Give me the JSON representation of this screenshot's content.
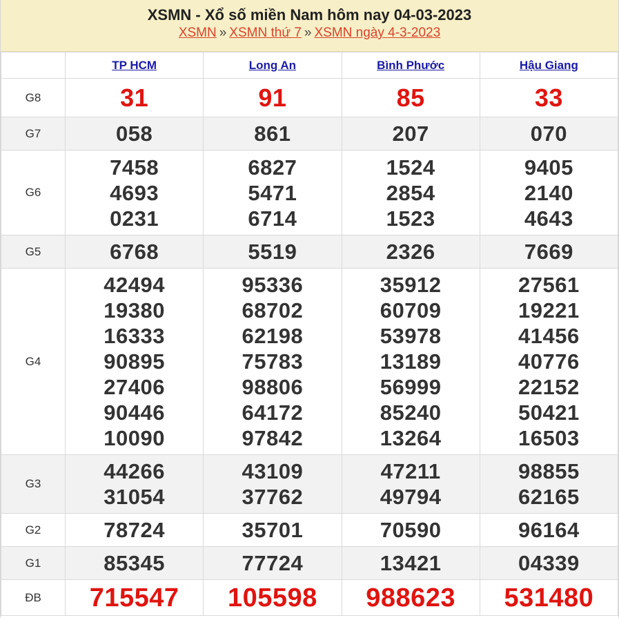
{
  "header": {
    "title": "XSMN - Xổ số miền Nam hôm nay 04-03-2023",
    "crumbs": [
      "XSMN",
      "XSMN thứ 7",
      "XSMN ngày 4-3-2023"
    ],
    "sep": "»"
  },
  "provinces": [
    "TP HCM",
    "Long An",
    "Bình Phước",
    "Hậu Giang"
  ],
  "prizes": [
    {
      "label": "G8",
      "red": true,
      "values": [
        [
          "31"
        ],
        [
          "91"
        ],
        [
          "85"
        ],
        [
          "33"
        ]
      ]
    },
    {
      "label": "G7",
      "values": [
        [
          "058"
        ],
        [
          "861"
        ],
        [
          "207"
        ],
        [
          "070"
        ]
      ]
    },
    {
      "label": "G6",
      "values": [
        [
          "7458",
          "4693",
          "0231"
        ],
        [
          "6827",
          "5471",
          "6714"
        ],
        [
          "1524",
          "2854",
          "1523"
        ],
        [
          "9405",
          "2140",
          "4643"
        ]
      ]
    },
    {
      "label": "G5",
      "values": [
        [
          "6768"
        ],
        [
          "5519"
        ],
        [
          "2326"
        ],
        [
          "7669"
        ]
      ]
    },
    {
      "label": "G4",
      "values": [
        [
          "42494",
          "19380",
          "16333",
          "90895",
          "27406",
          "90446",
          "10090"
        ],
        [
          "95336",
          "68702",
          "62198",
          "75783",
          "98806",
          "64172",
          "97842"
        ],
        [
          "35912",
          "60709",
          "53978",
          "13189",
          "56999",
          "85240",
          "13264"
        ],
        [
          "27561",
          "19221",
          "41456",
          "40776",
          "22152",
          "50421",
          "16503"
        ]
      ]
    },
    {
      "label": "G3",
      "values": [
        [
          "44266",
          "31054"
        ],
        [
          "43109",
          "37762"
        ],
        [
          "47211",
          "49794"
        ],
        [
          "98855",
          "62165"
        ]
      ]
    },
    {
      "label": "G2",
      "values": [
        [
          "78724"
        ],
        [
          "35701"
        ],
        [
          "70590"
        ],
        [
          "96164"
        ]
      ]
    },
    {
      "label": "G1",
      "values": [
        [
          "85345"
        ],
        [
          "77724"
        ],
        [
          "13421"
        ],
        [
          "04339"
        ]
      ]
    },
    {
      "label": "ĐB",
      "red": true,
      "values": [
        [
          "715547"
        ],
        [
          "105598"
        ],
        [
          "988623"
        ],
        [
          "531480"
        ]
      ]
    }
  ]
}
